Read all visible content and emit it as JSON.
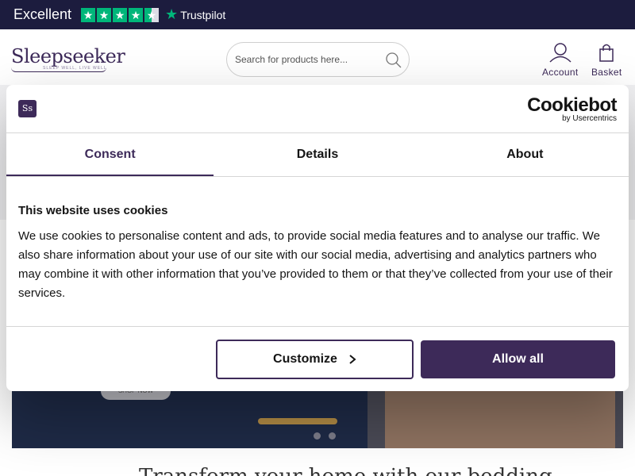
{
  "trustpilot": {
    "rating_word": "Excellent",
    "stars": 4.5,
    "brand": "Trustpilot",
    "star_color": "#00b67a"
  },
  "header": {
    "logo_name": "Sleepseeker",
    "logo_tagline": "SLEEP WELL, LIVE WELL",
    "search_placeholder": "Search for products here...",
    "account_label": "Account",
    "basket_label": "Basket",
    "brand_color": "#3d2a59"
  },
  "hero": {
    "button_label": "SHOP NOW",
    "slide_count": 2,
    "below_text": "Transform your home with our bedding"
  },
  "cookie": {
    "badge": "Ss",
    "brand_name": "Cookiebot",
    "brand_sub": "by Usercentrics",
    "tabs": [
      {
        "label": "Consent",
        "active": true
      },
      {
        "label": "Details",
        "active": false
      },
      {
        "label": "About",
        "active": false
      }
    ],
    "heading": "This website uses cookies",
    "text": "We use cookies to personalise content and ads, to provide social media features and to analyse our traffic. We also share information about your use of our site with our social media, advertising and analytics partners who may combine it with other information that you’ve provided to them or that they’ve collected from your use of their services.",
    "customize_label": "Customize",
    "allow_label": "Allow all"
  }
}
